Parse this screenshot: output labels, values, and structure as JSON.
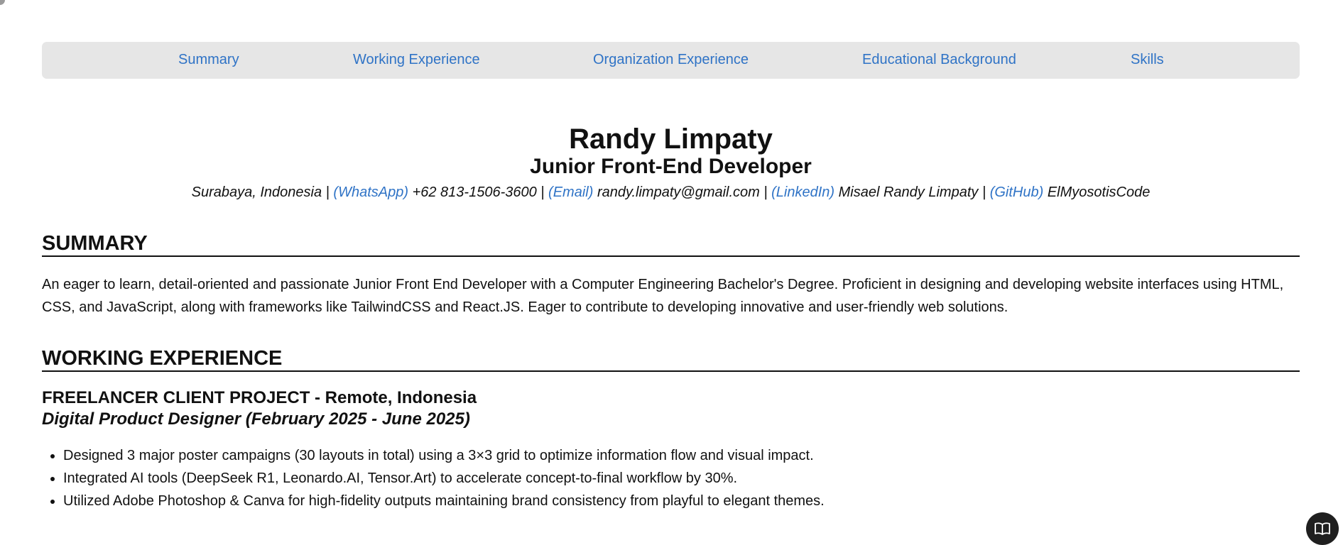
{
  "nav": {
    "items": [
      {
        "label": "Summary"
      },
      {
        "label": "Working Experience"
      },
      {
        "label": "Organization Experience"
      },
      {
        "label": "Educational Background"
      },
      {
        "label": "Skills"
      }
    ]
  },
  "header": {
    "name": "Randy Limpaty",
    "role": "Junior Front-End Developer",
    "location": "Surabaya, Indonesia",
    "separator": " | ",
    "whatsapp_label": "(WhatsApp)",
    "whatsapp_value": "+62 813-1506-3600",
    "email_label": "(Email)",
    "email_value": "randy.limpaty@gmail.com",
    "linkedin_label": "(LinkedIn)",
    "linkedin_value": "Misael Randy Limpaty",
    "github_label": "(GitHub)",
    "github_value": "ElMyosotisCode"
  },
  "summary": {
    "title": "SUMMARY",
    "text": "An eager to learn, detail-oriented and passionate Junior Front End Developer with a Computer Engineering Bachelor's Degree. Proficient in designing and developing website interfaces using HTML, CSS, and JavaScript, along with frameworks like TailwindCSS and React.JS. Eager to contribute to developing innovative and user-friendly web solutions."
  },
  "experience": {
    "title": "WORKING EXPERIENCE",
    "jobs": [
      {
        "company": "FREELANCER CLIENT PROJECT - Remote, Indonesia",
        "role": "Digital Product Designer (February 2025 - June 2025)",
        "bullets": [
          "Designed 3 major poster campaigns (30 layouts in total) using a 3×3 grid to optimize information flow and visual impact.",
          "Integrated AI tools (DeepSeek R1, Leonardo.AI, Tensor.Art) to accelerate concept-to-final workflow by 30%.",
          "Utilized Adobe Photoshop & Canva for high-fidelity outputs maintaining brand consistency from playful to elegant themes."
        ]
      }
    ]
  },
  "colors": {
    "link": "#2f73c6",
    "nav_background": "#e6e6e6",
    "text": "#111111"
  },
  "icons": {
    "floating_button": "book-open-icon"
  }
}
